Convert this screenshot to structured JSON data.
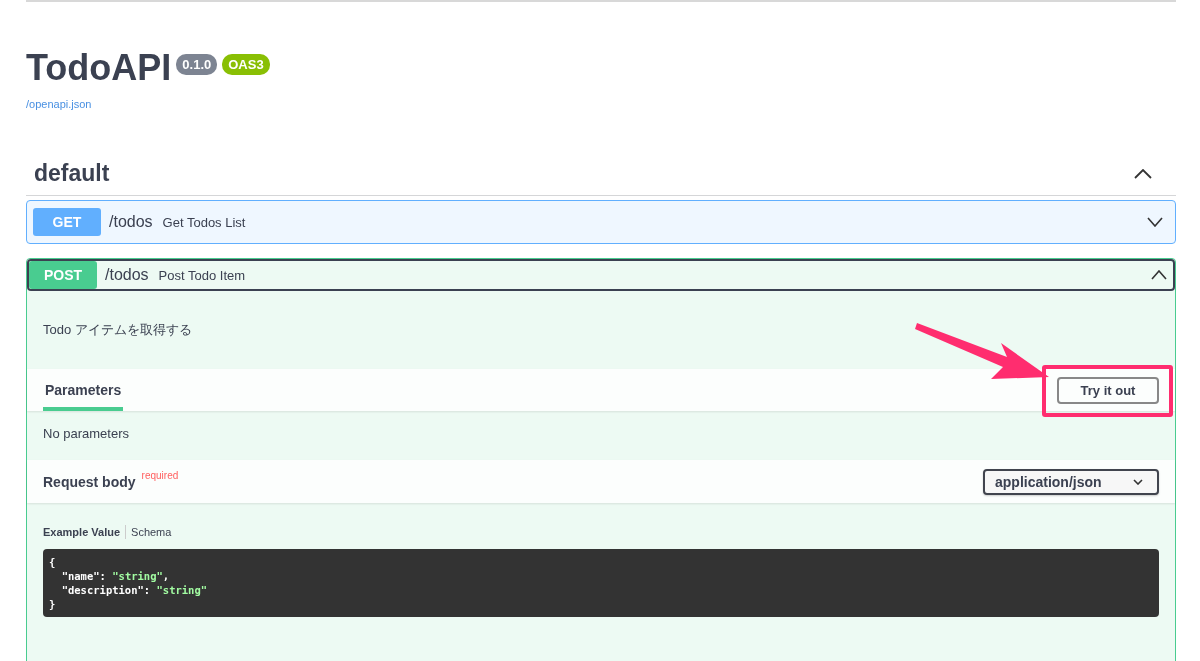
{
  "info": {
    "title": "TodoAPI",
    "version": "0.1.0",
    "spec": "OAS3",
    "link": "/openapi.json"
  },
  "tag": {
    "name": "default",
    "expanded": true
  },
  "operations": [
    {
      "method": "GET",
      "path": "/todos",
      "summary": "Get Todos List",
      "expanded": false
    },
    {
      "method": "POST",
      "path": "/todos",
      "summary": "Post Todo Item",
      "expanded": true,
      "description": "Todo アイテムを取得する",
      "tabs": [
        {
          "label": "Parameters",
          "selected": true
        }
      ],
      "try_button": "Try it out",
      "parameters_note": "No parameters",
      "request_body": {
        "label": "Request body",
        "required_label": "required",
        "content_type": "application/json",
        "example_tabs": [
          {
            "label": "Example Value",
            "selected": true
          },
          {
            "label": "Schema",
            "selected": false
          }
        ],
        "code_lines": [
          [
            {
              "text": "{",
              "kind": "punct"
            }
          ],
          [
            {
              "text": "  \"name\"",
              "kind": "key"
            },
            {
              "text": ": ",
              "kind": "punct"
            },
            {
              "text": "\"string\"",
              "kind": "string"
            },
            {
              "text": ",",
              "kind": "punct"
            }
          ],
          [
            {
              "text": "  \"description\"",
              "kind": "key"
            },
            {
              "text": ": ",
              "kind": "punct"
            },
            {
              "text": "\"string\"",
              "kind": "string"
            }
          ],
          [
            {
              "text": "}",
              "kind": "punct"
            }
          ]
        ]
      }
    }
  ]
}
